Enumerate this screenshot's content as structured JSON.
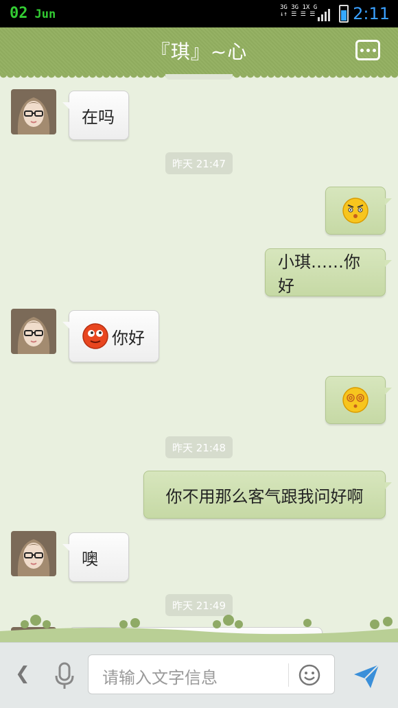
{
  "status_bar": {
    "day": "02",
    "month": "Jun",
    "time": "2:11",
    "network": [
      "3G 3G 1X G",
      "↓↑ ☰ ☰ ☰"
    ]
  },
  "header": {
    "title": "『琪』~心"
  },
  "messages": [
    {
      "side": "left",
      "text": "在吗",
      "avatar": "avatar-girl"
    },
    {
      "type": "time",
      "text": "昨天 21:47"
    },
    {
      "side": "right",
      "emoji": "angry-face-emoji"
    },
    {
      "side": "right",
      "text": "小琪……你好"
    },
    {
      "side": "left",
      "text": "你好",
      "emoji": "red-face-emoji",
      "avatar": "avatar-girl"
    },
    {
      "side": "right",
      "emoji": "dizzy-face-emoji"
    },
    {
      "type": "time",
      "text": "昨天 21:48"
    },
    {
      "side": "right",
      "text": "你不用那么客气跟我问好啊"
    },
    {
      "side": "left",
      "text": "噢",
      "avatar": "avatar-girl"
    },
    {
      "type": "time",
      "text": "昨天 21:49"
    }
  ],
  "input": {
    "placeholder": "请输入文字信息"
  },
  "colors": {
    "header": "#93ae62",
    "chat_bg": "#e9f0df",
    "right_bubble": "#cfe0b0",
    "time_pill": "#d6dccd",
    "send": "#3a8fd9"
  }
}
